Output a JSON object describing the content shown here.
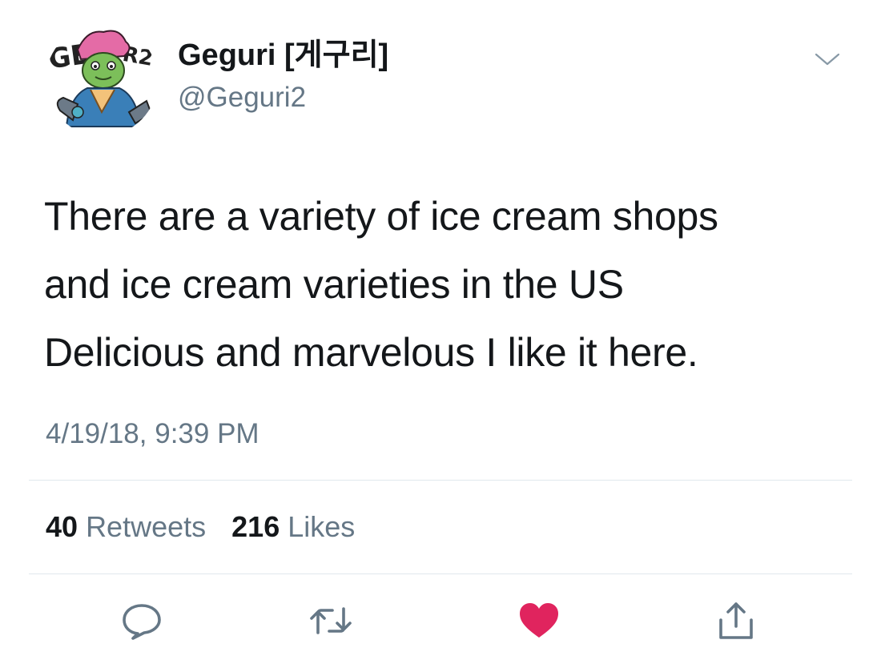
{
  "author": {
    "display_name": "Geguri  [게구리]",
    "handle": "@Geguri2",
    "avatar_badge_text": "GEGURI2"
  },
  "tweet": {
    "text": "There are a variety of ice cream shops\nand ice cream varieties in the US\nDelicious and marvelous  I like it here.",
    "timestamp": "4/19/18, 9:39 PM"
  },
  "stats": {
    "retweets_count": "40",
    "retweets_label": "Retweets",
    "likes_count": "216",
    "likes_label": "Likes"
  },
  "actions": {
    "reply_icon": "reply-icon",
    "retweet_icon": "retweet-icon",
    "like_icon": "heart-icon",
    "like_active": true,
    "share_icon": "share-icon"
  },
  "colors": {
    "text": "#14171a",
    "secondary": "#657786",
    "divider": "#e1e8ed",
    "like": "#e0245e"
  }
}
